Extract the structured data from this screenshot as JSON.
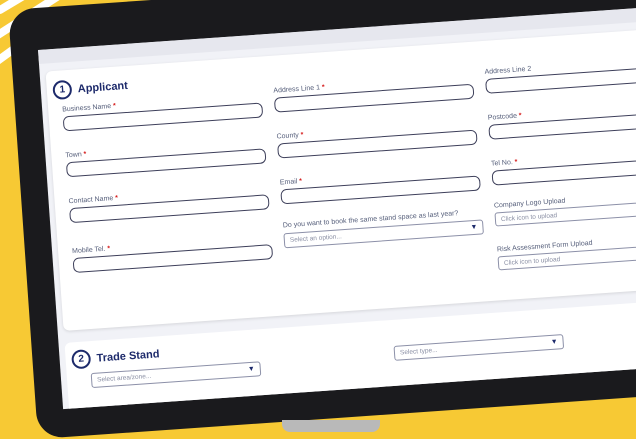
{
  "applicant": {
    "number": "1",
    "title": "Applicant",
    "fields": {
      "business_name": {
        "label": "Business Name",
        "required": "*"
      },
      "address_line_1": {
        "label": "Address Line 1",
        "required": "*"
      },
      "address_line_2": {
        "label": "Address Line 2"
      },
      "town": {
        "label": "Town",
        "required": "*"
      },
      "county": {
        "label": "County",
        "required": "*"
      },
      "postcode": {
        "label": "Postcode",
        "required": "*"
      },
      "contact_name": {
        "label": "Contact Name",
        "required": "*"
      },
      "email": {
        "label": "Email",
        "required": "*"
      },
      "tel_no": {
        "label": "Tel No.",
        "required": "*"
      },
      "mobile_tel": {
        "label": "Mobile Tel.",
        "required": "*"
      },
      "same_stand": {
        "label": "Do you want to book the same stand space as last year?",
        "placeholder": "Select an option..."
      },
      "company_logo": {
        "label": "Company Logo Upload",
        "placeholder": "Click icon to upload"
      },
      "risk_assessment": {
        "label": "Risk Assessment Form Upload",
        "placeholder": "Click icon to upload"
      }
    }
  },
  "trade_stand": {
    "number": "2",
    "title": "Trade Stand",
    "area_placeholder": "Select area/zone...",
    "type_placeholder": "Select type..."
  },
  "colors": {
    "accent": "#1d2a6b",
    "required": "#d51a1a",
    "background": "#f7c934"
  }
}
